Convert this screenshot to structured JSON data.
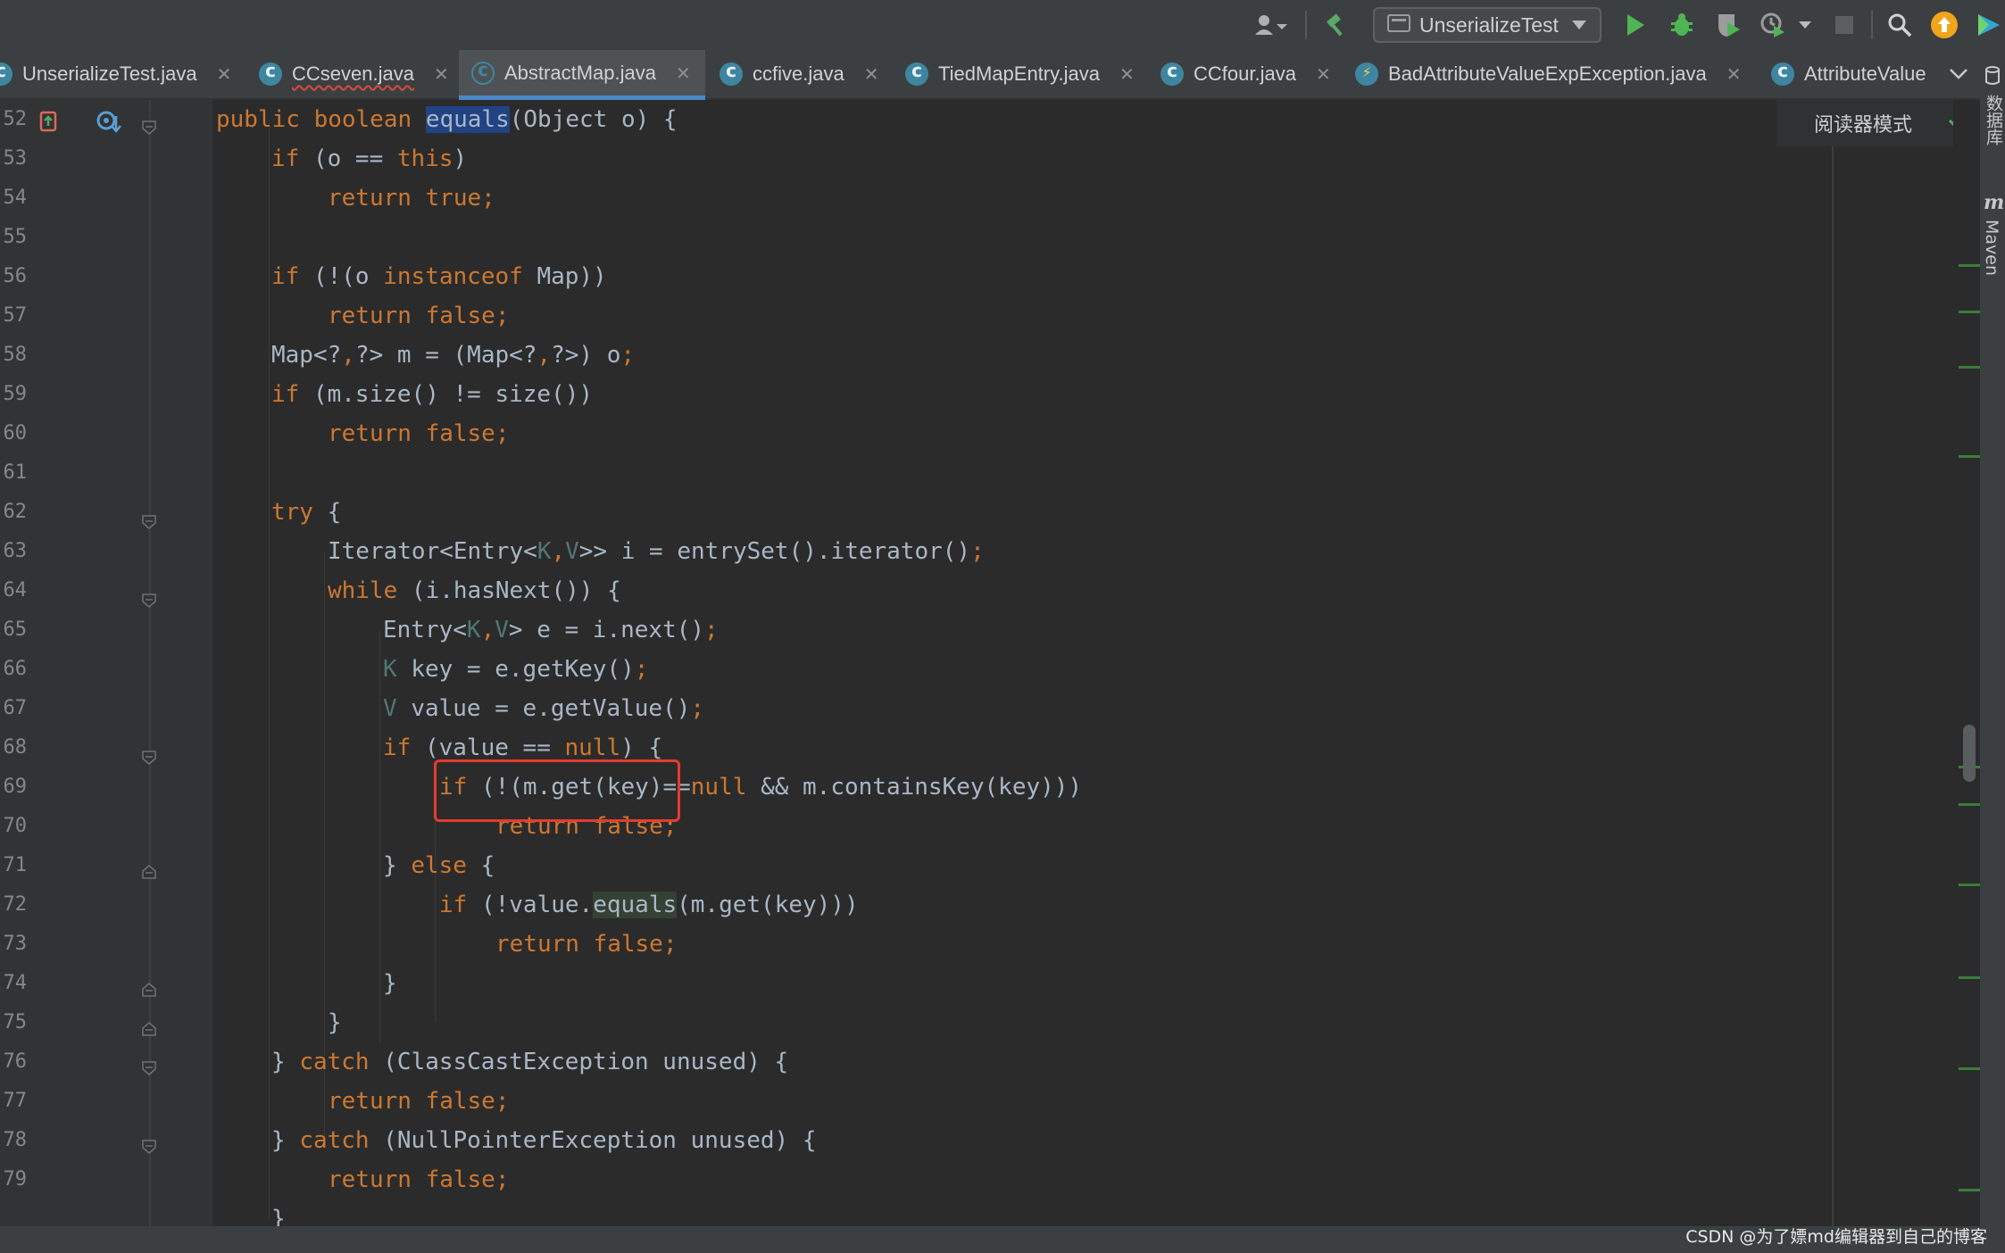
{
  "toolbar": {
    "run_config": "UnserializeTest",
    "icons": [
      "user-icon",
      "build-hammer-icon",
      "run-icon",
      "debug-icon",
      "coverage-icon",
      "profile-icon",
      "stop-icon",
      "search-icon",
      "update-icon",
      "plugin-icon"
    ]
  },
  "tabs": [
    {
      "label": "UnserializeTest.java",
      "icon": "class-icon"
    },
    {
      "label": "CCseven.java",
      "icon": "class-icon"
    },
    {
      "label": "AbstractMap.java",
      "icon": "abstract-class-icon",
      "active": true
    },
    {
      "label": "ccfive.java",
      "icon": "class-icon"
    },
    {
      "label": "TiedMapEntry.java",
      "icon": "class-icon"
    },
    {
      "label": "CCfour.java",
      "icon": "class-icon"
    },
    {
      "label": "BadAttributeValueExpException.java",
      "icon": "exception-class-icon"
    },
    {
      "label": "AttributeValue",
      "icon": "class-icon"
    }
  ],
  "editor": {
    "reader_mode": "阅读器模式",
    "line_numbers": [
      "52",
      "53",
      "54",
      "55",
      "56",
      "57",
      "58",
      "59",
      "60",
      "61",
      "62",
      "63",
      "64",
      "65",
      "66",
      "67",
      "68",
      "69",
      "70",
      "71",
      "72",
      "73",
      "74",
      "75",
      "76",
      "77",
      "78",
      "79"
    ],
    "lines": [
      "public boolean equals(Object o) {",
      "    if (o == this)",
      "        return true;",
      "",
      "    if (!(o instanceof Map))",
      "        return false;",
      "    Map<?,?> m = (Map<?,?>) o;",
      "    if (m.size() != size())",
      "        return false;",
      "",
      "    try {",
      "        Iterator<Entry<K,V>> i = entrySet().iterator();",
      "        while (i.hasNext()) {",
      "            Entry<K,V> e = i.next();",
      "            K key = e.getKey();",
      "            V value = e.getValue();",
      "            if (value == null) {",
      "                if (!(m.get(key)==null && m.containsKey(key)))",
      "                    return false;",
      "            } else {",
      "                if (!value.equals(m.get(key)))",
      "                    return false;",
      "            }",
      "        }",
      "    } catch (ClassCastException unused) {",
      "        return false;",
      "    } catch (NullPointerException unused) {",
      "        return false;"
    ],
    "annotation": "red box around: if (!(m.get(key)="
  },
  "side_panels": [
    "数据库",
    "Maven"
  ],
  "watermark": "CSDN @为了嫖md编辑器到自己的博客"
}
